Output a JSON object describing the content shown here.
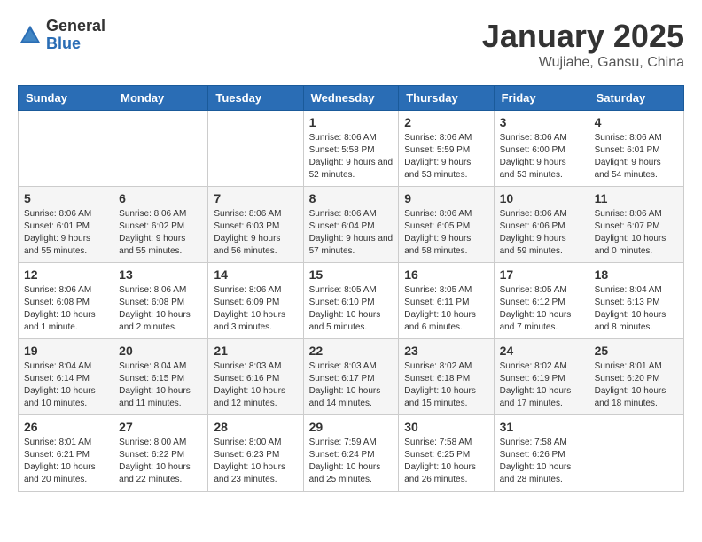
{
  "header": {
    "logo_general": "General",
    "logo_blue": "Blue",
    "title": "January 2025",
    "location": "Wujiahe, Gansu, China"
  },
  "days_of_week": [
    "Sunday",
    "Monday",
    "Tuesday",
    "Wednesday",
    "Thursday",
    "Friday",
    "Saturday"
  ],
  "weeks": [
    [
      {
        "day": "",
        "info": ""
      },
      {
        "day": "",
        "info": ""
      },
      {
        "day": "",
        "info": ""
      },
      {
        "day": "1",
        "info": "Sunrise: 8:06 AM\nSunset: 5:58 PM\nDaylight: 9 hours and 52 minutes."
      },
      {
        "day": "2",
        "info": "Sunrise: 8:06 AM\nSunset: 5:59 PM\nDaylight: 9 hours and 53 minutes."
      },
      {
        "day": "3",
        "info": "Sunrise: 8:06 AM\nSunset: 6:00 PM\nDaylight: 9 hours and 53 minutes."
      },
      {
        "day": "4",
        "info": "Sunrise: 8:06 AM\nSunset: 6:01 PM\nDaylight: 9 hours and 54 minutes."
      }
    ],
    [
      {
        "day": "5",
        "info": "Sunrise: 8:06 AM\nSunset: 6:01 PM\nDaylight: 9 hours and 55 minutes."
      },
      {
        "day": "6",
        "info": "Sunrise: 8:06 AM\nSunset: 6:02 PM\nDaylight: 9 hours and 55 minutes."
      },
      {
        "day": "7",
        "info": "Sunrise: 8:06 AM\nSunset: 6:03 PM\nDaylight: 9 hours and 56 minutes."
      },
      {
        "day": "8",
        "info": "Sunrise: 8:06 AM\nSunset: 6:04 PM\nDaylight: 9 hours and 57 minutes."
      },
      {
        "day": "9",
        "info": "Sunrise: 8:06 AM\nSunset: 6:05 PM\nDaylight: 9 hours and 58 minutes."
      },
      {
        "day": "10",
        "info": "Sunrise: 8:06 AM\nSunset: 6:06 PM\nDaylight: 9 hours and 59 minutes."
      },
      {
        "day": "11",
        "info": "Sunrise: 8:06 AM\nSunset: 6:07 PM\nDaylight: 10 hours and 0 minutes."
      }
    ],
    [
      {
        "day": "12",
        "info": "Sunrise: 8:06 AM\nSunset: 6:08 PM\nDaylight: 10 hours and 1 minute."
      },
      {
        "day": "13",
        "info": "Sunrise: 8:06 AM\nSunset: 6:08 PM\nDaylight: 10 hours and 2 minutes."
      },
      {
        "day": "14",
        "info": "Sunrise: 8:06 AM\nSunset: 6:09 PM\nDaylight: 10 hours and 3 minutes."
      },
      {
        "day": "15",
        "info": "Sunrise: 8:05 AM\nSunset: 6:10 PM\nDaylight: 10 hours and 5 minutes."
      },
      {
        "day": "16",
        "info": "Sunrise: 8:05 AM\nSunset: 6:11 PM\nDaylight: 10 hours and 6 minutes."
      },
      {
        "day": "17",
        "info": "Sunrise: 8:05 AM\nSunset: 6:12 PM\nDaylight: 10 hours and 7 minutes."
      },
      {
        "day": "18",
        "info": "Sunrise: 8:04 AM\nSunset: 6:13 PM\nDaylight: 10 hours and 8 minutes."
      }
    ],
    [
      {
        "day": "19",
        "info": "Sunrise: 8:04 AM\nSunset: 6:14 PM\nDaylight: 10 hours and 10 minutes."
      },
      {
        "day": "20",
        "info": "Sunrise: 8:04 AM\nSunset: 6:15 PM\nDaylight: 10 hours and 11 minutes."
      },
      {
        "day": "21",
        "info": "Sunrise: 8:03 AM\nSunset: 6:16 PM\nDaylight: 10 hours and 12 minutes."
      },
      {
        "day": "22",
        "info": "Sunrise: 8:03 AM\nSunset: 6:17 PM\nDaylight: 10 hours and 14 minutes."
      },
      {
        "day": "23",
        "info": "Sunrise: 8:02 AM\nSunset: 6:18 PM\nDaylight: 10 hours and 15 minutes."
      },
      {
        "day": "24",
        "info": "Sunrise: 8:02 AM\nSunset: 6:19 PM\nDaylight: 10 hours and 17 minutes."
      },
      {
        "day": "25",
        "info": "Sunrise: 8:01 AM\nSunset: 6:20 PM\nDaylight: 10 hours and 18 minutes."
      }
    ],
    [
      {
        "day": "26",
        "info": "Sunrise: 8:01 AM\nSunset: 6:21 PM\nDaylight: 10 hours and 20 minutes."
      },
      {
        "day": "27",
        "info": "Sunrise: 8:00 AM\nSunset: 6:22 PM\nDaylight: 10 hours and 22 minutes."
      },
      {
        "day": "28",
        "info": "Sunrise: 8:00 AM\nSunset: 6:23 PM\nDaylight: 10 hours and 23 minutes."
      },
      {
        "day": "29",
        "info": "Sunrise: 7:59 AM\nSunset: 6:24 PM\nDaylight: 10 hours and 25 minutes."
      },
      {
        "day": "30",
        "info": "Sunrise: 7:58 AM\nSunset: 6:25 PM\nDaylight: 10 hours and 26 minutes."
      },
      {
        "day": "31",
        "info": "Sunrise: 7:58 AM\nSunset: 6:26 PM\nDaylight: 10 hours and 28 minutes."
      },
      {
        "day": "",
        "info": ""
      }
    ]
  ]
}
